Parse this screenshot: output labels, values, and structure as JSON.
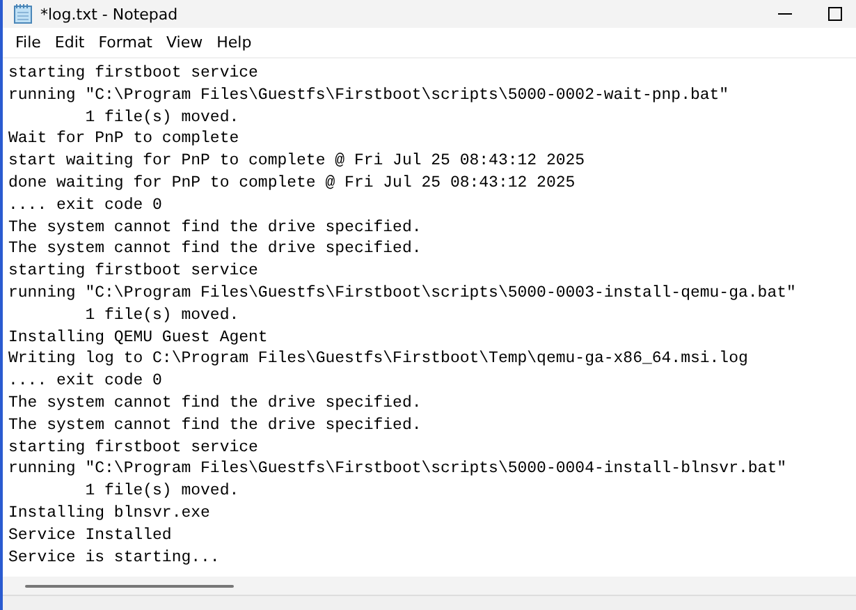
{
  "window": {
    "title": "*log.txt - Notepad"
  },
  "menu": [
    "File",
    "Edit",
    "Format",
    "View",
    "Help"
  ],
  "lines": [
    "starting firstboot service",
    "running \"C:\\Program Files\\Guestfs\\Firstboot\\scripts\\5000-0002-wait-pnp.bat\"",
    "        1 file(s) moved.",
    "Wait for PnP to complete",
    "start waiting for PnP to complete @ Fri Jul 25 08:43:12 2025",
    "done waiting for PnP to complete @ Fri Jul 25 08:43:12 2025",
    ".... exit code 0",
    "The system cannot find the drive specified.",
    "The system cannot find the drive specified.",
    "starting firstboot service",
    "running \"C:\\Program Files\\Guestfs\\Firstboot\\scripts\\5000-0003-install-qemu-ga.bat\"",
    "        1 file(s) moved.",
    "Installing QEMU Guest Agent",
    "Writing log to C:\\Program Files\\Guestfs\\Firstboot\\Temp\\qemu-ga-x86_64.msi.log",
    ".... exit code 0",
    "The system cannot find the drive specified.",
    "The system cannot find the drive specified.",
    "starting firstboot service",
    "running \"C:\\Program Files\\Guestfs\\Firstboot\\scripts\\5000-0004-install-blnsvr.bat\"",
    "        1 file(s) moved.",
    "Installing blnsvr.exe",
    "Service Installed",
    "Service is starting..."
  ]
}
